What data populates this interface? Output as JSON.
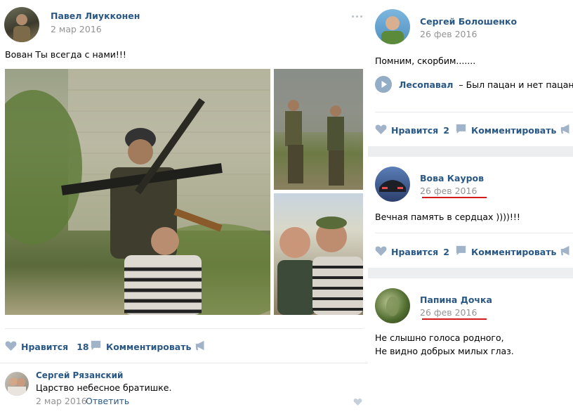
{
  "main_post": {
    "author": "Павел Лиукконен",
    "date": "2 мар 2016",
    "text": "Вован Ты всегда с нами!!!",
    "like_label": "Нравится",
    "like_count": "18",
    "comment_label": "Комментировать"
  },
  "comment": {
    "author": "Сергей Рязанский",
    "text": "Царство небесное братишке.",
    "date": "2 мар 2016",
    "reply_label": "Ответить"
  },
  "right_posts": [
    {
      "author": "Сергей Болошенко",
      "date": "26 фев 2016",
      "text": "Помним, скорбим.......",
      "audio_artist": "Лесопавал",
      "audio_title": "– Был пацан и нет пацана",
      "like_label": "Нравится",
      "like_count": "2",
      "comment_label": "Комментировать"
    },
    {
      "author": "Вова Кауров",
      "date": "26 фев 2016",
      "text": "Вечная память в сердцах ))))!!!",
      "like_label": "Нравится",
      "like_count": "2",
      "comment_label": "Комментировать"
    },
    {
      "author": "Папина Дочка",
      "date": "26 фев 2016",
      "text_line1": "Не слышно голоса родного,",
      "text_line2": "Не видно добрых милых глаз."
    }
  ],
  "colors": {
    "link": "#2a5885",
    "muted": "#939393",
    "icon": "#a1b3c8",
    "annotation": "#d21b1b"
  }
}
